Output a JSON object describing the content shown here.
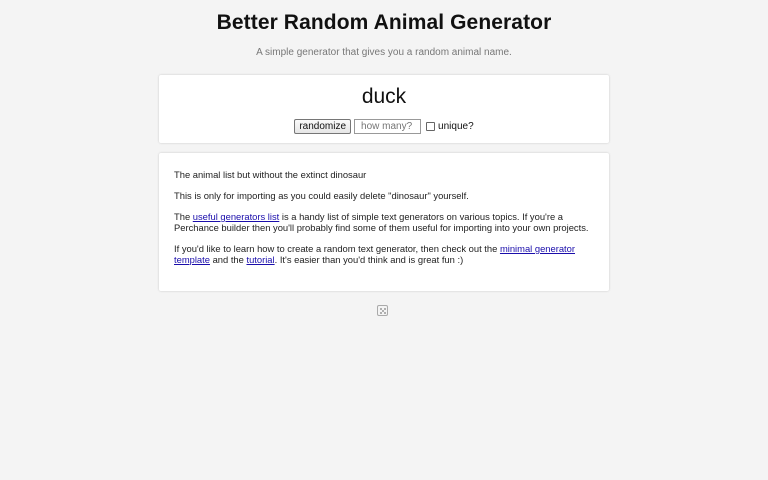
{
  "header": {
    "title": "Better Random Animal Generator",
    "subtitle": "A simple generator that gives you a random animal name."
  },
  "generator": {
    "result": "duck",
    "randomize_label": "randomize",
    "quantity_placeholder": "how many?",
    "unique_label": "unique?",
    "unique_checked": false
  },
  "info": {
    "line1": "The animal list but without the extinct dinosaur",
    "line2": "This is only for importing as you could easily delete \"dinosaur\" yourself.",
    "para3_before": "The ",
    "para3_link": "useful generators list",
    "para3_after": " is a handy list of simple text generators on various topics. If you're a Perchance builder then you'll probably find some of them useful for importing into your own projects.",
    "para4_before": "If you'd like to learn how to create a random text generator, then check out the ",
    "para4_link1": "minimal generator template",
    "para4_middle": " and the ",
    "para4_link2": "tutorial",
    "para4_after": ". It's easier than you'd think and is great fun :)"
  },
  "footer": {
    "icon": "dice-icon"
  }
}
